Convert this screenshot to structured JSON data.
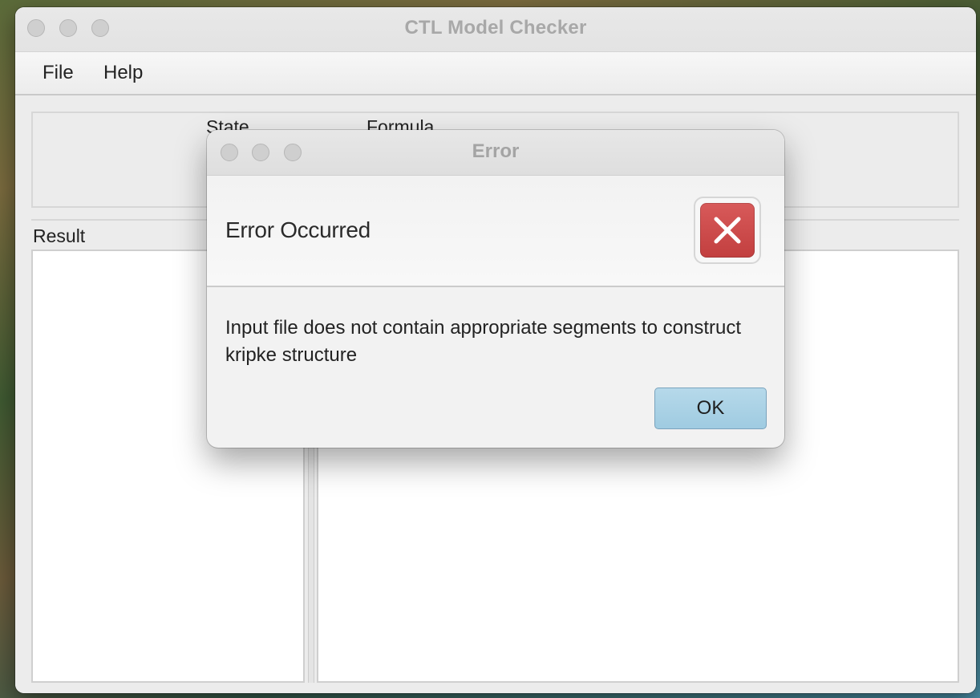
{
  "window": {
    "title": "CTL Model Checker"
  },
  "menu": {
    "items": [
      {
        "label": "File"
      },
      {
        "label": "Help"
      }
    ]
  },
  "panel": {
    "state_label": "State",
    "formula_label": "Formula",
    "result_label": "Result"
  },
  "dialog": {
    "title": "Error",
    "heading": "Error Occurred",
    "message": "Input file does not contain appropriate segments to construct kripke structure",
    "ok_label": "OK",
    "icon": "error-x-icon"
  },
  "colors": {
    "error_icon": "#c94545",
    "ok_button": "#a9d1e6",
    "traffic_light": "#cfcfcf"
  }
}
